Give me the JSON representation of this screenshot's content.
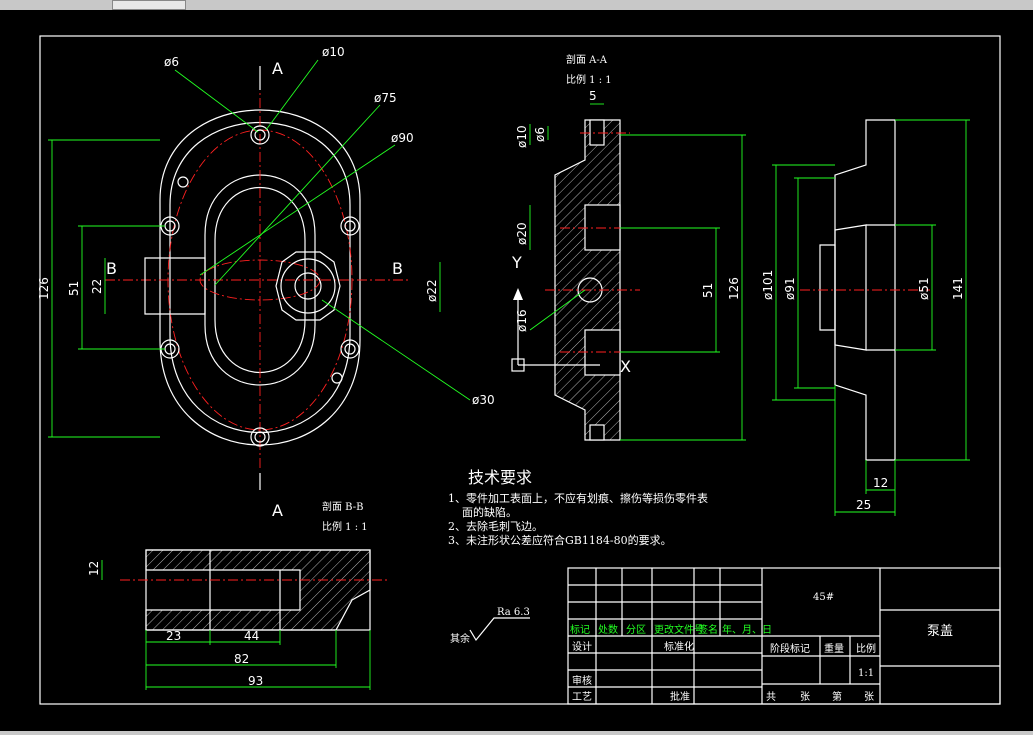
{
  "window": {
    "title_bar_visible": true
  },
  "colors": {
    "background": "#000000",
    "outline": "#ffffff",
    "centerline": "#ff2020",
    "dimension": "#22ff22"
  },
  "front_view": {
    "section_marks": [
      "A",
      "A",
      "B",
      "B"
    ],
    "dims": [
      "ø6",
      "ø10",
      "ø75",
      "ø90",
      "ø22",
      "ø30",
      "126",
      "51",
      "22"
    ]
  },
  "section_aa": {
    "title": "剖面  A-A",
    "scale": "比例  1 : 1",
    "dims": [
      "5",
      "ø10",
      "ø6",
      "ø20",
      "ø16",
      "51",
      "126"
    ],
    "axis_y": "Y",
    "axis_x": "X"
  },
  "side_view": {
    "dims": [
      "ø101",
      "ø91",
      "ø51",
      "141",
      "12",
      "25"
    ]
  },
  "section_bb": {
    "title": "剖面  B-B",
    "scale": "比例  1 : 1",
    "dims": [
      "12",
      "23",
      "44",
      "82",
      "93"
    ]
  },
  "tech_requirements": {
    "heading": "技术要求",
    "lines": [
      "1、零件加工表面上，不应有划痕、擦伤等损伤零件表",
      "面的缺陷。",
      "2、去除毛刺飞边。",
      "3、未注形状公差应符合GB1184-80的要求。"
    ]
  },
  "roughness": {
    "label": "其余",
    "value": "Ra 6.3"
  },
  "title_block": {
    "material": "45#",
    "part_name": "泵盖",
    "headers": [
      "标记",
      "处数",
      "分区",
      "更改文件号",
      "签名",
      "年、月、日"
    ],
    "design": "设计",
    "standardize": "标准化",
    "stage_mark": "阶段标记",
    "weight": "重量",
    "scale_label": "比例",
    "scale_value": "1:1",
    "review": "审核",
    "process": "工艺",
    "approve": "批准",
    "sheet_total": "共",
    "sheet_unit1": "张",
    "sheet_no": "第",
    "sheet_unit2": "张"
  }
}
